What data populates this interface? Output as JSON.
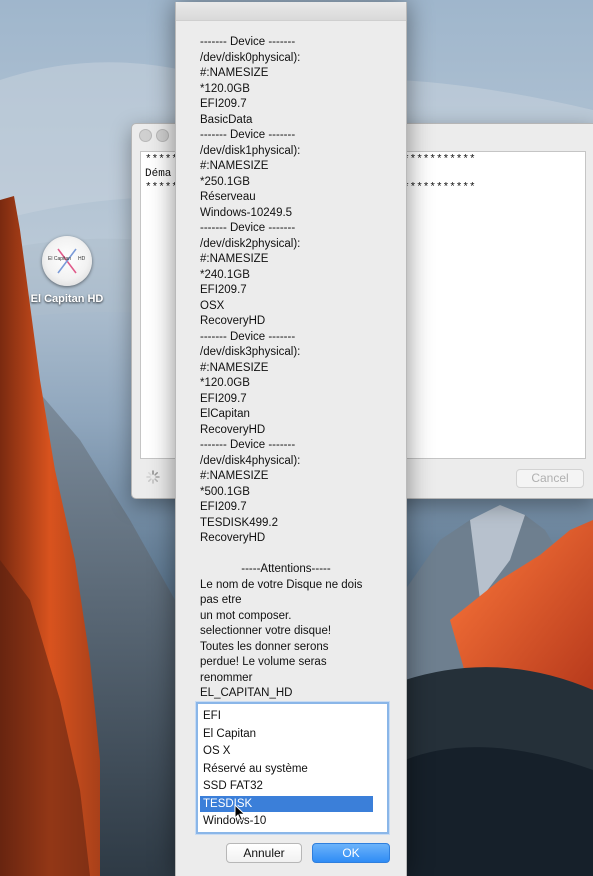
{
  "desktop": {
    "icon_label": "El Capitan HD",
    "icon_text_left": "El Capitan",
    "icon_text_right": "HD"
  },
  "background_window": {
    "console_lines": [
      "*****",
      "Déma",
      "*****",
      "***********",
      "***********"
    ],
    "cancel_label": "Cancel"
  },
  "dialog": {
    "message_lines": [
      "------- Device -------",
      "/dev/disk0physical):",
      "#:NAMESIZE",
      "*120.0GB",
      "EFI209.7",
      "BasicData",
      "------- Device -------",
      "/dev/disk1physical):",
      "#:NAMESIZE",
      "*250.1GB",
      "Réserveau",
      "Windows-10249.5",
      "------- Device -------",
      "/dev/disk2physical):",
      "#:NAMESIZE",
      "*240.1GB",
      "EFI209.7",
      "OSX",
      "RecoveryHD",
      "------- Device -------",
      "/dev/disk3physical):",
      "#:NAMESIZE",
      "*120.0GB",
      "EFI209.7",
      "ElCapitan",
      "RecoveryHD",
      "------- Device -------",
      "/dev/disk4physical):",
      "#:NAMESIZE",
      "*500.1GB",
      "EFI209.7",
      "TESDISK499.2",
      "RecoveryHD",
      "",
      "-----Attentions-----",
      "Le nom de votre Disque ne dois",
      "pas etre",
      "un mot composer.",
      "selectionner votre disque!",
      "Toutes les donner serons",
      "perdue! Le volume seras",
      "renommer",
      "EL_CAPITAN_HD"
    ],
    "choices": [
      {
        "label": "EFI",
        "selected": false
      },
      {
        "label": "El Capitan",
        "selected": false
      },
      {
        "label": "OS X",
        "selected": false
      },
      {
        "label": "Réservé au système",
        "selected": false
      },
      {
        "label": "SSD FAT32",
        "selected": false
      },
      {
        "label": "TESDISK",
        "selected": true
      },
      {
        "label": "Windows-10",
        "selected": false
      }
    ],
    "cancel_label": "Annuler",
    "ok_label": "OK"
  },
  "colors": {
    "selection": "#3b7fd9",
    "default_button": "#2f8cf5",
    "list_focus_ring": "#8ab6e8"
  }
}
